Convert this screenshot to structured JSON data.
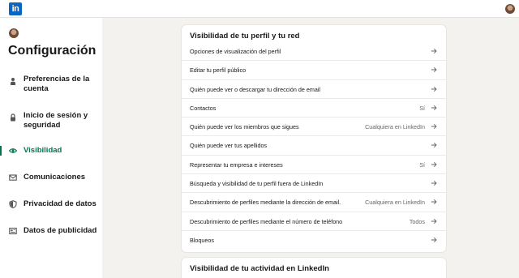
{
  "header": {
    "logo_text": "in"
  },
  "sidebar": {
    "title": "Configuración",
    "items": [
      {
        "label": "Preferencias de la cuenta",
        "icon": "person-icon",
        "active": false
      },
      {
        "label": "Inicio de sesión y seguridad",
        "icon": "lock-icon",
        "active": false
      },
      {
        "label": "Visibilidad",
        "icon": "eye-icon",
        "active": true
      },
      {
        "label": "Comunicaciones",
        "icon": "envelope-icon",
        "active": false
      },
      {
        "label": "Privacidad de datos",
        "icon": "shield-icon",
        "active": false
      },
      {
        "label": "Datos de publicidad",
        "icon": "newspaper-icon",
        "active": false
      }
    ]
  },
  "main": {
    "section1": {
      "title": "Visibilidad de tu perfil y tu red",
      "rows": [
        {
          "label": "Opciones de visualización del perfil",
          "value": ""
        },
        {
          "label": "Editar tu perfil público",
          "value": ""
        },
        {
          "label": "Quién puede ver o descargar tu dirección de email",
          "value": ""
        },
        {
          "label": "Contactos",
          "value": "Sí"
        },
        {
          "label": "Quién puede ver los miembros que sigues",
          "value": "Cualquiera en LinkedIn"
        },
        {
          "label": "Quién puede ver tus apellidos",
          "value": ""
        },
        {
          "label": "Representar tu empresa e intereses",
          "value": "Sí"
        },
        {
          "label": "Búsqueda y visibilidad de tu perfil fuera de LinkedIn",
          "value": ""
        },
        {
          "label": "Descubrimiento de perfiles mediante la dirección de email.",
          "value": "Cualquiera en LinkedIn"
        },
        {
          "label": "Descubrimiento de perfiles mediante el número de teléfono",
          "value": "Todos"
        },
        {
          "label": "Bloqueos",
          "value": ""
        }
      ]
    },
    "section2": {
      "title": "Visibilidad de tu actividad en LinkedIn"
    }
  },
  "colors": {
    "accent_green": "#01754f",
    "brand_blue": "#0a66c2",
    "background": "#f4f2ee"
  }
}
